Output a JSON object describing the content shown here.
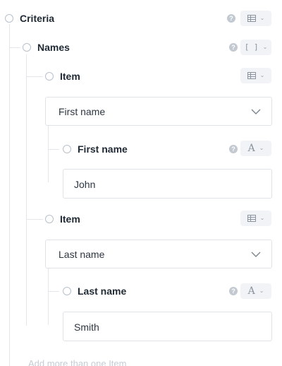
{
  "criteria": {
    "label": "Criteria",
    "help_glyph": "?",
    "type_icon": "table-icon"
  },
  "names": {
    "label": "Names",
    "help_glyph": "?",
    "type_glyph": "[ ]"
  },
  "items": [
    {
      "label": "Item",
      "type_icon": "table-icon",
      "select_value": "First name",
      "field": {
        "label": "First name",
        "help_glyph": "?",
        "type_glyph": "A",
        "value": "John"
      }
    },
    {
      "label": "Item",
      "type_icon": "table-icon",
      "select_value": "Last name",
      "field": {
        "label": "Last name",
        "help_glyph": "?",
        "type_glyph": "A",
        "value": "Smith"
      }
    }
  ],
  "add_more_label": "Add more than one Item",
  "colors": {
    "line": "#e3e7ec",
    "radio_border": "#b8c0ca",
    "button_bg": "#f1f3f6",
    "help_bg": "#c3c9d1",
    "muted_text": "#c5ccd4"
  }
}
